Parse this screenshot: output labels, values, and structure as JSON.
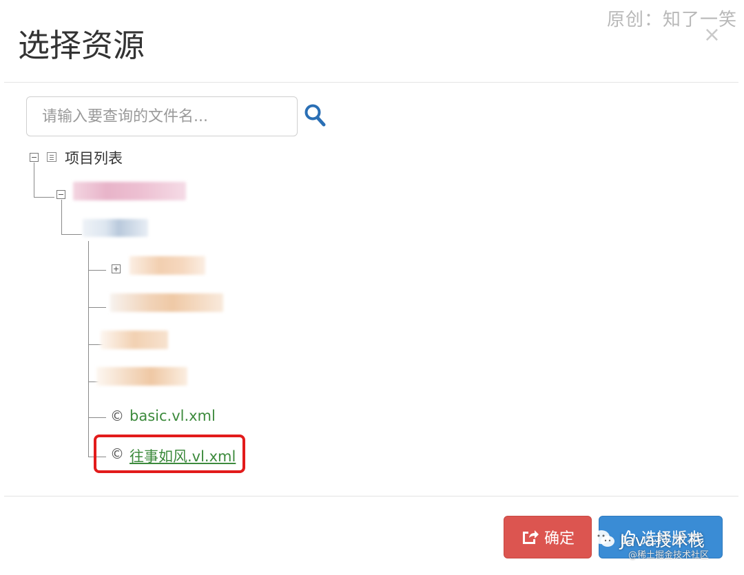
{
  "watermark": {
    "top_text": "原创：知了一笑",
    "bottom_text": "Java技术栈",
    "bottom_sub": "@稀土掘金技术社区"
  },
  "modal": {
    "title": "选择资源",
    "close_glyph": "×"
  },
  "search": {
    "placeholder": "请输入要查询的文件名...",
    "icon": "search-icon"
  },
  "tree": {
    "root_label": "项目列表",
    "files": [
      {
        "label": "basic.vl.xml",
        "icon": "copyright-file-icon",
        "glyph": "©"
      },
      {
        "label": "往事如风.vl.xml",
        "icon": "copyright-file-icon",
        "glyph": "©",
        "highlighted": true
      }
    ]
  },
  "footer": {
    "confirm_label": "确定",
    "confirm_icon": "share-icon",
    "select_label": "选择版本",
    "select_icon": "thumbs-up-icon"
  },
  "colors": {
    "confirm": "#dc5550",
    "select": "#3a8cd5",
    "file_text": "#3c8a3c",
    "search_icon": "#2a6fb5",
    "highlight": "#e21b1b"
  }
}
